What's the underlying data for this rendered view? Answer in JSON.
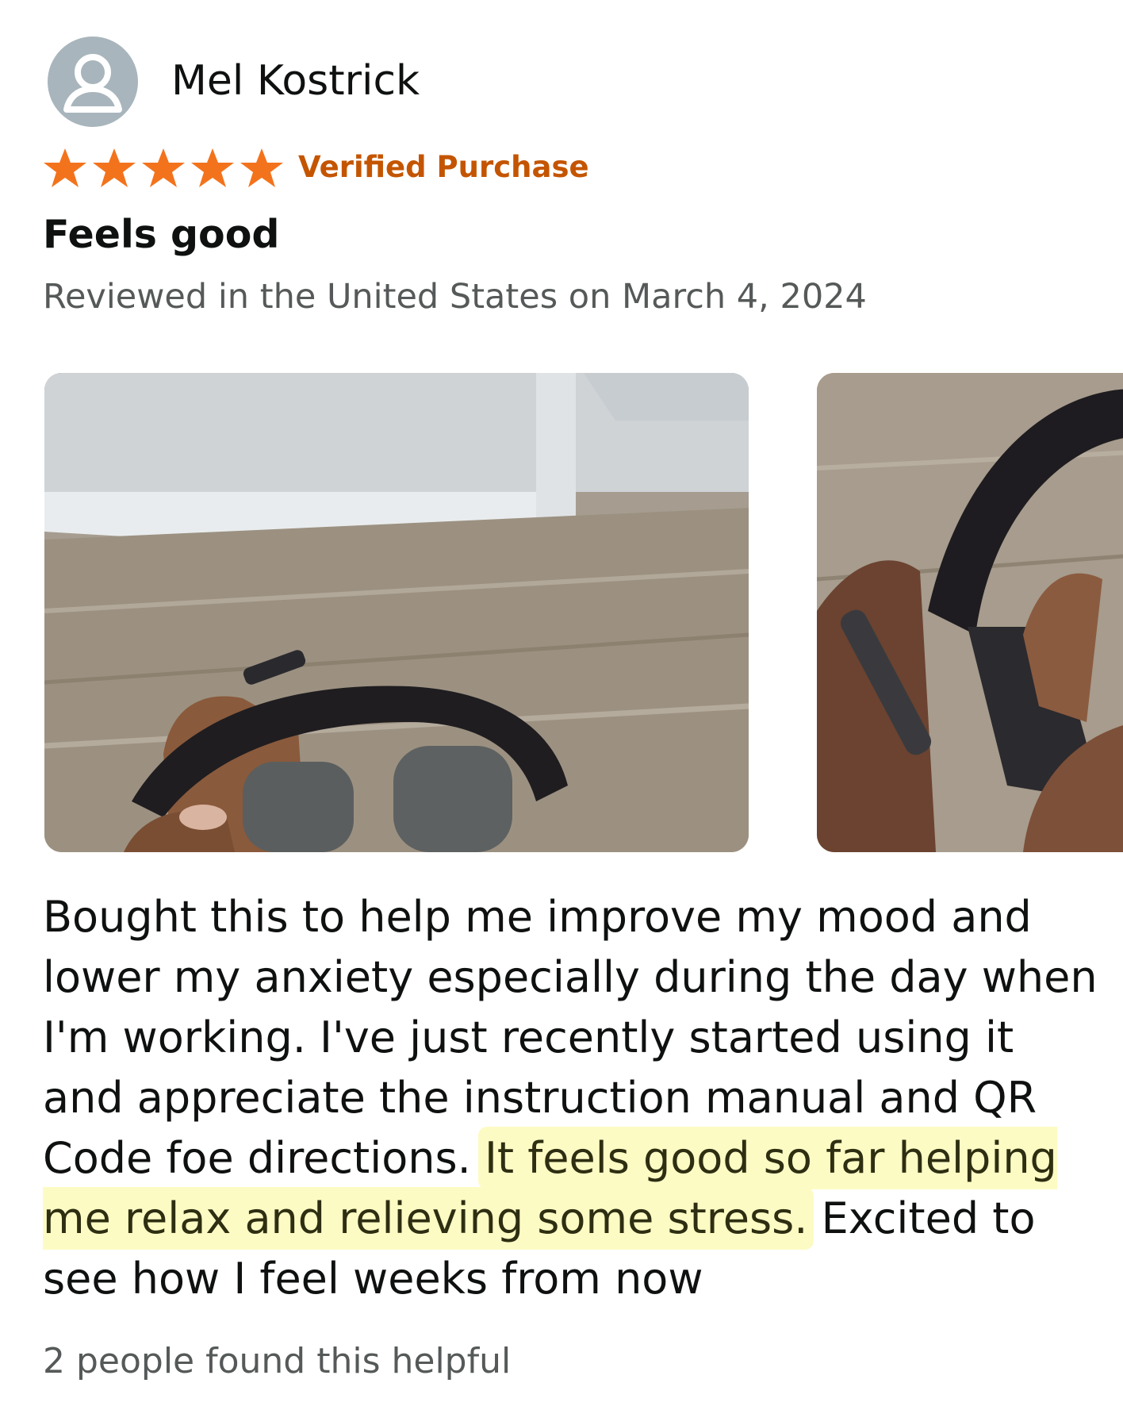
{
  "review": {
    "reviewer_name": "Mel Kostrick",
    "avatar_icon": "person-silhouette-icon",
    "rating": 5,
    "rating_max": 5,
    "star_color": "#f3731c",
    "badge": "Verified Purchase",
    "badge_color": "#c45500",
    "title": "Feels good",
    "date_line": "Reviewed in the United States on March 4, 2024",
    "body": {
      "text_before": "Bought this to help me improve my mood and lower my anxiety especially during the day when I'm working. I've just recently started using it and appreciate the instruction manual and QR Code foe directions.",
      "highlighted": "It feels good so far helping me relax and relieving some stress.",
      "text_after": "Excited to see how I feel weeks from now",
      "highlight_color": "#fdfbc4"
    },
    "helpful_text": "2 people found this helpful"
  }
}
